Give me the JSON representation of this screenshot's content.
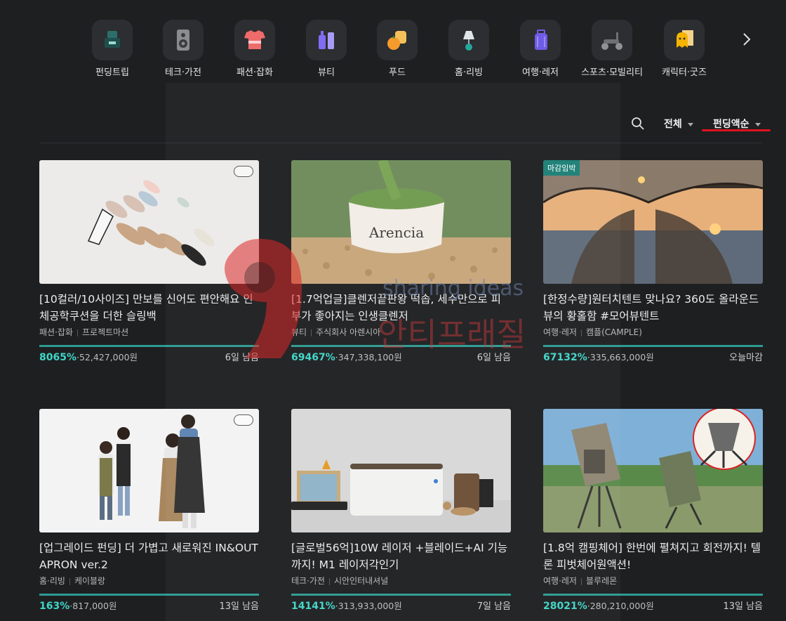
{
  "categories": [
    {
      "label": "펀딩트립",
      "icon": "funding-trip-icon"
    },
    {
      "label": "테크·가전",
      "icon": "speaker-icon"
    },
    {
      "label": "패션·잡화",
      "icon": "shirt-icon"
    },
    {
      "label": "뷰티",
      "icon": "cosmetics-icon"
    },
    {
      "label": "푸드",
      "icon": "food-icon"
    },
    {
      "label": "홈·리빙",
      "icon": "lamp-icon"
    },
    {
      "label": "여행·레저",
      "icon": "suitcase-icon"
    },
    {
      "label": "스포츠·모빌리티",
      "icon": "scooter-icon"
    },
    {
      "label": "캐릭터·굿즈",
      "icon": "character-icon"
    }
  ],
  "filters": {
    "all": "전체",
    "sort": "펀딩액순"
  },
  "watermark": {
    "text1": "sharing ideas",
    "text2": "안티프래질"
  },
  "colors": {
    "accent": "#3fd6c7",
    "progress": "#2d9b91",
    "underline": "#e0121d",
    "badge": "#1a7f76"
  },
  "cards": [
    {
      "title": "[10컬러/10사이즈] 만보를 신어도 편안해요 인체공학쿠션을 더한 슬링백",
      "category": "패션·잡화",
      "maker": "프로젝트마션",
      "percent": "8065%",
      "amount": "·52,427,000원",
      "days": "6일 남음",
      "badge": ""
    },
    {
      "title": "[1.7억업글]클렌저끝판왕 떡솝, 세수만으로 피부가 좋아지는 인생클렌저",
      "category": "뷰티",
      "maker": "주식회사 아렌시아",
      "percent": "69467%",
      "amount": "·347,338,100원",
      "days": "6일 남음",
      "badge": "",
      "product_text": "Arencia"
    },
    {
      "title": "[한정수량]원터치텐트 맞나요? 360도 올라운드 뷰의 황홀함 #모어뷰텐트",
      "category": "여행·레저",
      "maker": "캠플(CAMPLE)",
      "percent": "67132%",
      "amount": "·335,663,000원",
      "days": "오늘마감",
      "badge": "마감임박"
    },
    {
      "title": "[업그레이드 펀딩] 더 가볍고 새로워진 IN&OUT APRON ver.2",
      "category": "홈·리빙",
      "maker": "케이블랑",
      "percent": "163%",
      "amount": "·817,000원",
      "days": "13일 남음",
      "badge": ""
    },
    {
      "title": "[글로벌56억]10W 레이저 +블레이드+AI 기능까지! M1 레이저각인기",
      "category": "테크·가전",
      "maker": "시안인터내셔널",
      "percent": "14141%",
      "amount": "·313,933,000원",
      "days": "7일 남음",
      "badge": ""
    },
    {
      "title": "[1.8억 캠핑체어] 한번에 펼쳐지고 회전까지! 텔론 피벗체어원액션!",
      "category": "여행·레저",
      "maker": "블루레몬",
      "percent": "28021%",
      "amount": "·280,210,000원",
      "days": "13일 남음",
      "badge": ""
    }
  ]
}
